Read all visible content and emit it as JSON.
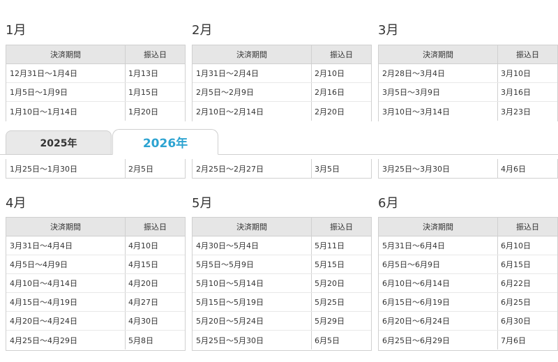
{
  "tabs": [
    {
      "label": "2025年",
      "active": false
    },
    {
      "label": "2026年",
      "active": true
    }
  ],
  "colors": {
    "active_tab_text": "#2ca3d1",
    "header_bg": "#e6e6e6",
    "border": "#d0d0d0"
  },
  "columns": {
    "period": "決済期間",
    "transfer": "振込日"
  },
  "top_months": [
    {
      "title": "1月",
      "rows": [
        [
          "12月31日〜1月4日",
          "1月13日"
        ],
        [
          "1月5日〜1月9日",
          "1月15日"
        ],
        [
          "1月10日〜1月14日",
          "1月20日"
        ]
      ],
      "tail_row": [
        "1月25日〜1月30日",
        "2月5日"
      ]
    },
    {
      "title": "2月",
      "rows": [
        [
          "1月31日〜2月4日",
          "2月10日"
        ],
        [
          "2月5日〜2月9日",
          "2月16日"
        ],
        [
          "2月10日〜2月14日",
          "2月20日"
        ]
      ],
      "tail_row": [
        "2月25日〜2月27日",
        "3月5日"
      ]
    },
    {
      "title": "3月",
      "rows": [
        [
          "2月28日〜3月4日",
          "3月10日"
        ],
        [
          "3月5日〜3月9日",
          "3月16日"
        ],
        [
          "3月10日〜3月14日",
          "3月23日"
        ]
      ],
      "tail_row": [
        "3月25日〜3月30日",
        "4月6日"
      ]
    }
  ],
  "bottom_months": [
    {
      "title": "4月",
      "rows": [
        [
          "3月31日〜4月4日",
          "4月10日"
        ],
        [
          "4月5日〜4月9日",
          "4月15日"
        ],
        [
          "4月10日〜4月14日",
          "4月20日"
        ],
        [
          "4月15日〜4月19日",
          "4月27日"
        ],
        [
          "4月20日〜4月24日",
          "4月30日"
        ],
        [
          "4月25日〜4月29日",
          "5月8日"
        ]
      ]
    },
    {
      "title": "5月",
      "rows": [
        [
          "4月30日〜5月4日",
          "5月11日"
        ],
        [
          "5月5日〜5月9日",
          "5月15日"
        ],
        [
          "5月10日〜5月14日",
          "5月20日"
        ],
        [
          "5月15日〜5月19日",
          "5月25日"
        ],
        [
          "5月20日〜5月24日",
          "5月29日"
        ],
        [
          "5月25日〜5月30日",
          "6月5日"
        ]
      ]
    },
    {
      "title": "6月",
      "rows": [
        [
          "5月31日〜6月4日",
          "6月10日"
        ],
        [
          "6月5日〜6月9日",
          "6月15日"
        ],
        [
          "6月10日〜6月14日",
          "6月22日"
        ],
        [
          "6月15日〜6月19日",
          "6月25日"
        ],
        [
          "6月20日〜6月24日",
          "6月30日"
        ],
        [
          "6月25日〜6月29日",
          "7月6日"
        ]
      ]
    }
  ]
}
